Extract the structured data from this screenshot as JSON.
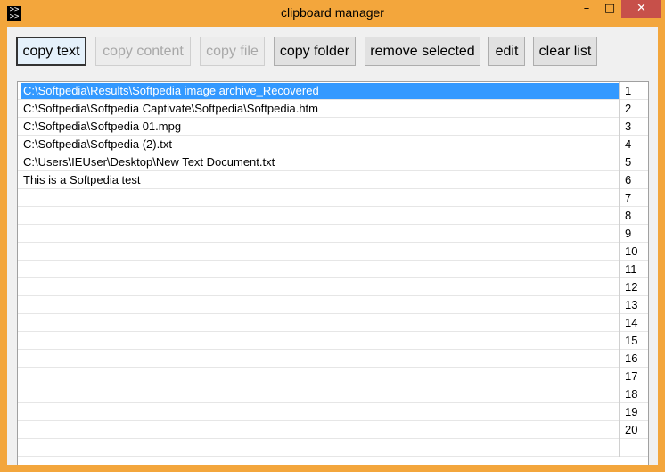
{
  "window": {
    "title": "clipboard manager",
    "minimize_glyph": "–",
    "maximize_glyph": "□",
    "close_glyph": "✕",
    "app_icon": "terminal-icon"
  },
  "toolbar": {
    "copy_text": "copy text",
    "copy_content": "copy content",
    "copy_file": "copy file",
    "copy_folder": "copy folder",
    "remove_selected": "remove selected",
    "edit": "edit",
    "clear_list": "clear list"
  },
  "list": {
    "selected_index": 0,
    "rows": [
      {
        "text": "C:\\Softpedia\\Results\\Softpedia image archive_Recovered",
        "num": "1"
      },
      {
        "text": "C:\\Softpedia\\Softpedia Captivate\\Softpedia\\Softpedia.htm",
        "num": "2"
      },
      {
        "text": "C:\\Softpedia\\Softpedia 01.mpg",
        "num": "3"
      },
      {
        "text": "C:\\Softpedia\\Softpedia (2).txt",
        "num": "4"
      },
      {
        "text": "C:\\Users\\IEUser\\Desktop\\New Text Document.txt",
        "num": "5"
      },
      {
        "text": "This is a Softpedia test",
        "num": "6"
      },
      {
        "text": "",
        "num": "7"
      },
      {
        "text": "",
        "num": "8"
      },
      {
        "text": "",
        "num": "9"
      },
      {
        "text": "",
        "num": "10"
      },
      {
        "text": "",
        "num": "11"
      },
      {
        "text": "",
        "num": "12"
      },
      {
        "text": "",
        "num": "13"
      },
      {
        "text": "",
        "num": "14"
      },
      {
        "text": "",
        "num": "15"
      },
      {
        "text": "",
        "num": "16"
      },
      {
        "text": "",
        "num": "17"
      },
      {
        "text": "",
        "num": "18"
      },
      {
        "text": "",
        "num": "19"
      },
      {
        "text": "",
        "num": "20"
      },
      {
        "text": "",
        "num": ""
      }
    ]
  },
  "colors": {
    "frame": "#f3a63c",
    "close_button": "#c7504a",
    "selection": "#3399ff"
  }
}
